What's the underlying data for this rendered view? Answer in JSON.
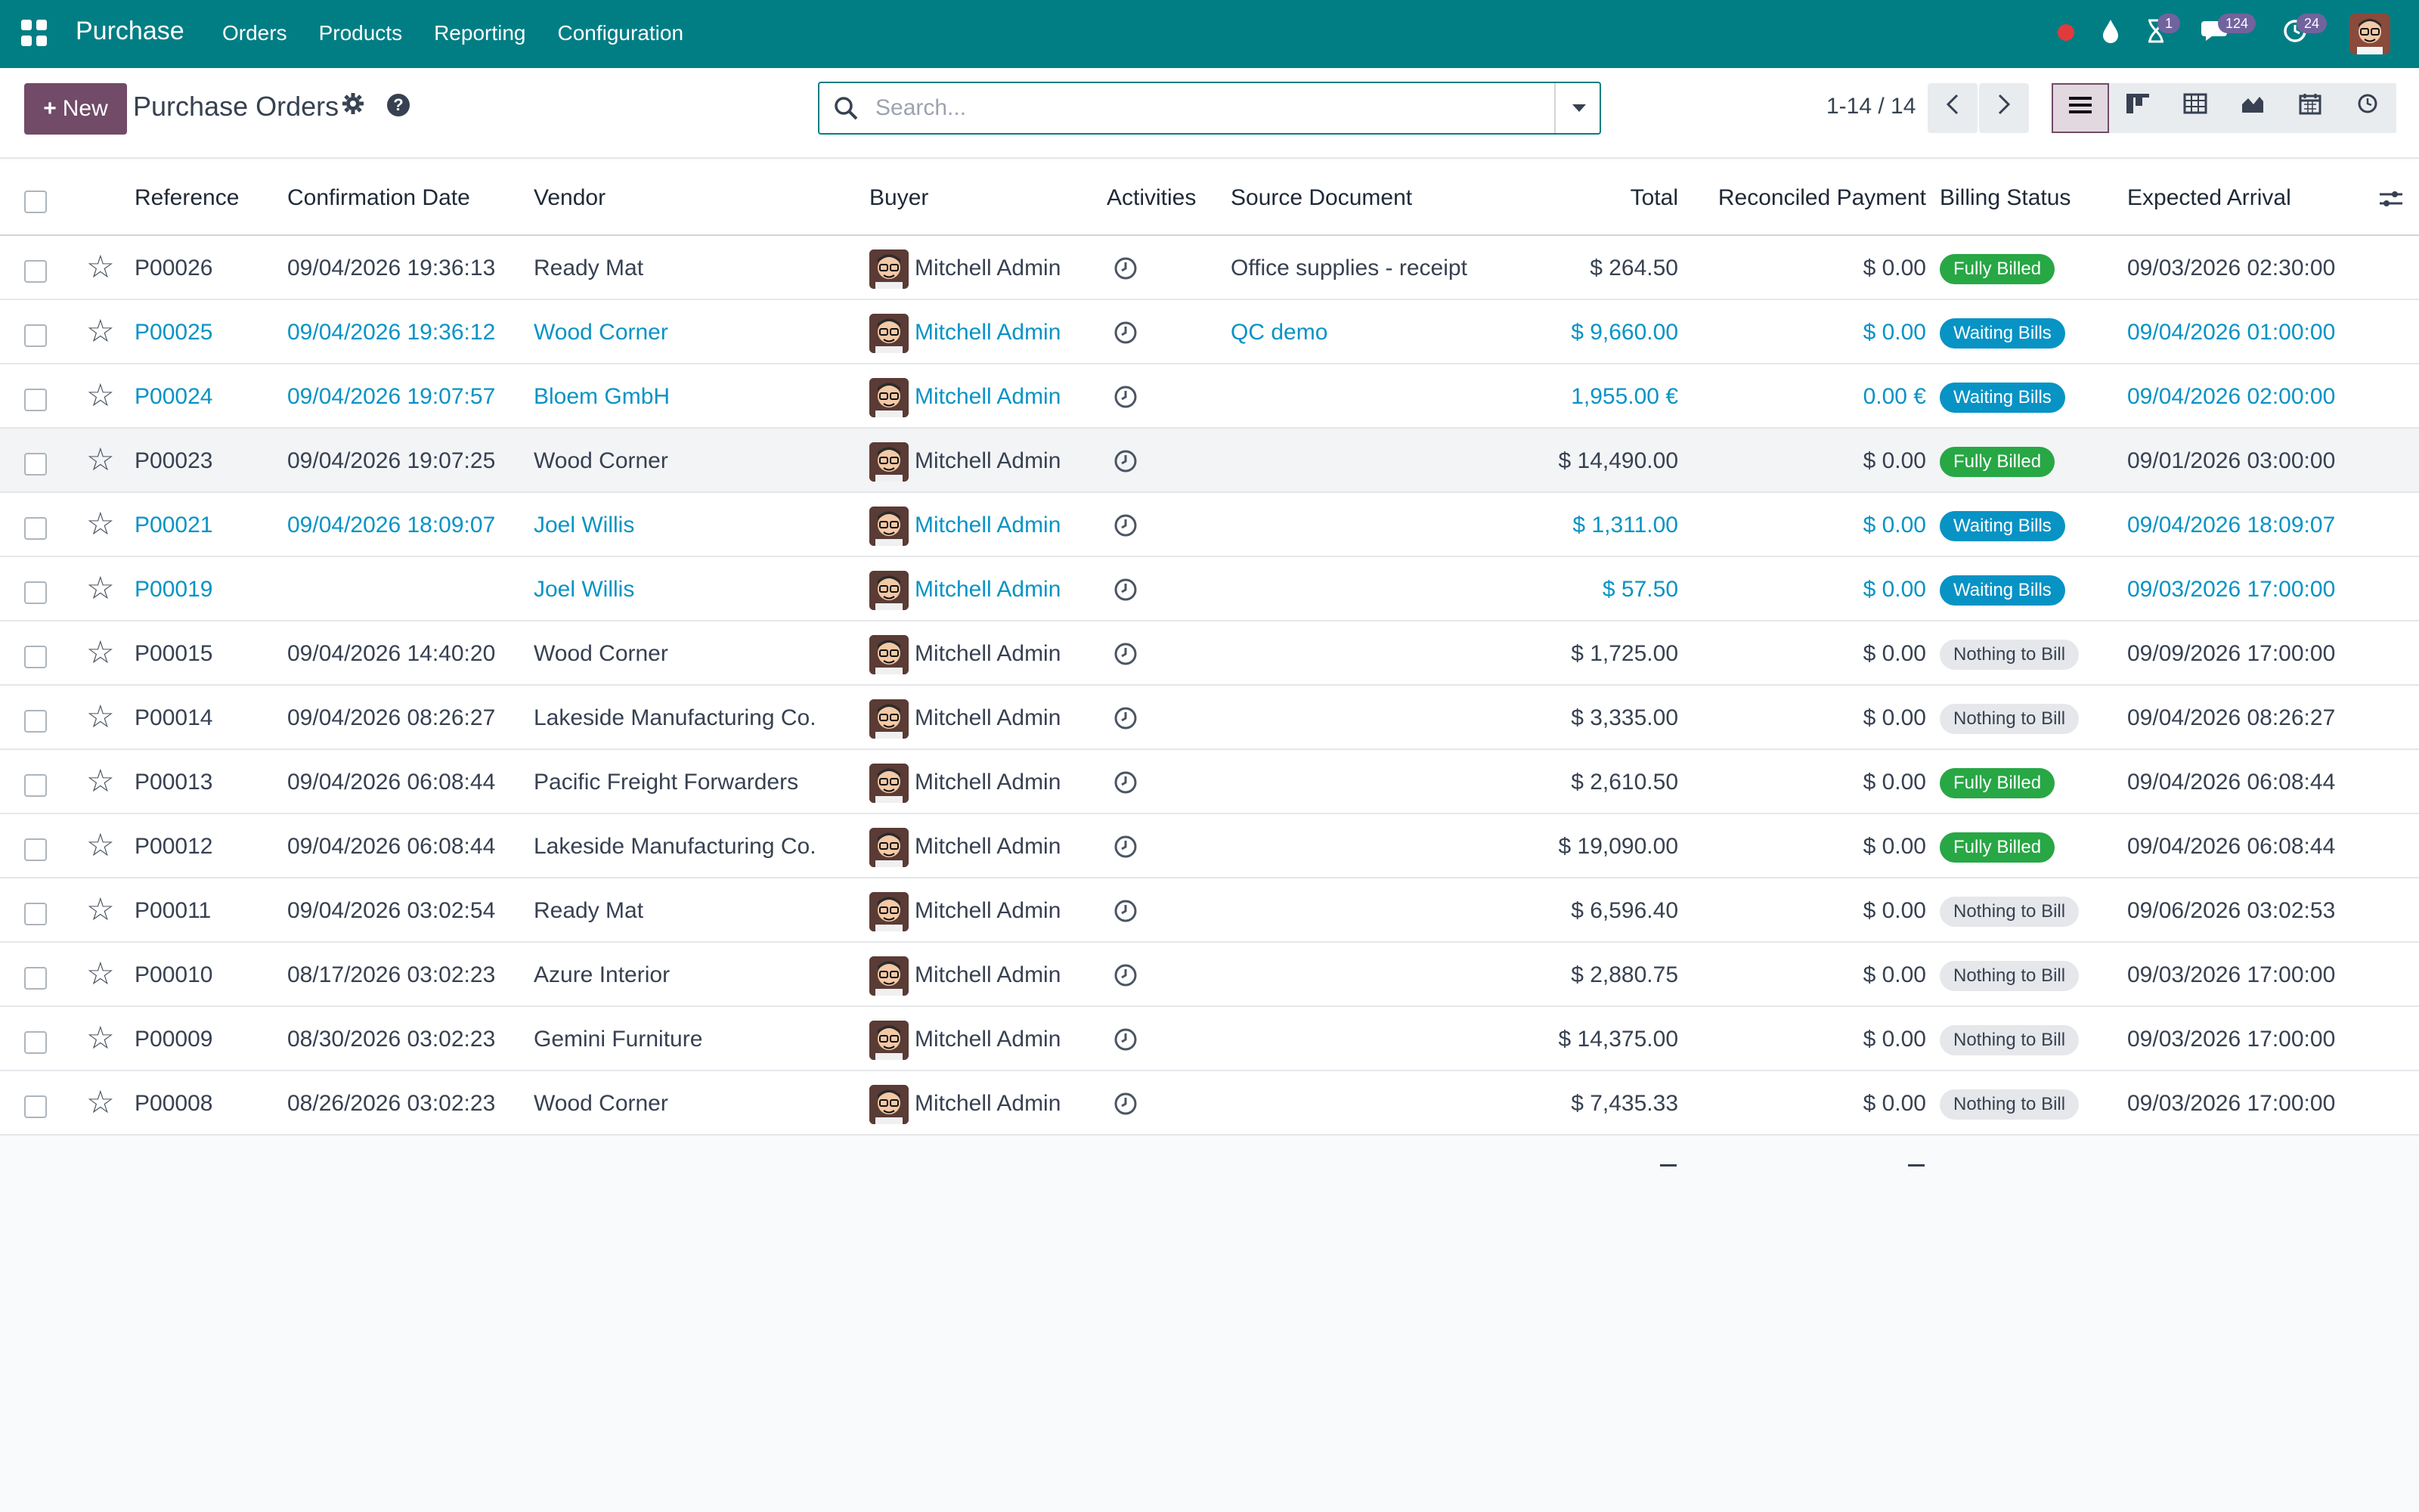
{
  "navbar": {
    "app_name": "Purchase",
    "menu": [
      "Orders",
      "Products",
      "Reporting",
      "Configuration"
    ],
    "activity_count": "1",
    "messages_count": "124",
    "activities_count": "24",
    "color": "#017e84"
  },
  "control": {
    "new_label": "New",
    "title": "Purchase Orders",
    "search_placeholder": "Search...",
    "pager": "1-14 / 14"
  },
  "columns": {
    "reference": "Reference",
    "confirmation_date": "Confirmation Date",
    "vendor": "Vendor",
    "buyer": "Buyer",
    "activities": "Activities",
    "source_document": "Source Document",
    "total": "Total",
    "reconciled_payment": "Reconciled Payment",
    "billing_status": "Billing Status",
    "expected_arrival": "Expected Arrival"
  },
  "rows": [
    {
      "ref": "P00026",
      "date": "09/04/2026 19:36:13",
      "vendor": "Ready Mat",
      "buyer": "Mitchell Admin",
      "source": "Office supplies - receipt",
      "total": "$ 264.50",
      "paid": "$ 0.00",
      "status": "Fully Billed",
      "status_kind": "fully",
      "arrival": "09/03/2026 02:30:00",
      "blue": false
    },
    {
      "ref": "P00025",
      "date": "09/04/2026 19:36:12",
      "vendor": "Wood Corner",
      "buyer": "Mitchell Admin",
      "source": "QC demo",
      "total": "$ 9,660.00",
      "paid": "$ 0.00",
      "status": "Waiting Bills",
      "status_kind": "waiting",
      "arrival": "09/04/2026 01:00:00",
      "blue": true
    },
    {
      "ref": "P00024",
      "date": "09/04/2026 19:07:57",
      "vendor": "Bloem GmbH",
      "buyer": "Mitchell Admin",
      "source": "",
      "total": "1,955.00 €",
      "paid": "0.00 €",
      "status": "Waiting Bills",
      "status_kind": "waiting",
      "arrival": "09/04/2026 02:00:00",
      "blue": true
    },
    {
      "ref": "P00023",
      "date": "09/04/2026 19:07:25",
      "vendor": "Wood Corner",
      "buyer": "Mitchell Admin",
      "source": "",
      "total": "$ 14,490.00",
      "paid": "$ 0.00",
      "status": "Fully Billed",
      "status_kind": "fully",
      "arrival": "09/01/2026 03:00:00",
      "blue": false
    },
    {
      "ref": "P00021",
      "date": "09/04/2026 18:09:07",
      "vendor": "Joel Willis",
      "buyer": "Mitchell Admin",
      "source": "",
      "total": "$ 1,311.00",
      "paid": "$ 0.00",
      "status": "Waiting Bills",
      "status_kind": "waiting",
      "arrival": "09/04/2026 18:09:07",
      "blue": true
    },
    {
      "ref": "P00019",
      "date": "",
      "vendor": "Joel Willis",
      "buyer": "Mitchell Admin",
      "source": "",
      "total": "$ 57.50",
      "paid": "$ 0.00",
      "status": "Waiting Bills",
      "status_kind": "waiting",
      "arrival": "09/03/2026 17:00:00",
      "blue": true
    },
    {
      "ref": "P00015",
      "date": "09/04/2026 14:40:20",
      "vendor": "Wood Corner",
      "buyer": "Mitchell Admin",
      "source": "",
      "total": "$ 1,725.00",
      "paid": "$ 0.00",
      "status": "Nothing to Bill",
      "status_kind": "nothing",
      "arrival": "09/09/2026 17:00:00",
      "blue": false
    },
    {
      "ref": "P00014",
      "date": "09/04/2026 08:26:27",
      "vendor": "Lakeside Manufacturing Co.",
      "buyer": "Mitchell Admin",
      "source": "",
      "total": "$ 3,335.00",
      "paid": "$ 0.00",
      "status": "Nothing to Bill",
      "status_kind": "nothing",
      "arrival": "09/04/2026 08:26:27",
      "blue": false
    },
    {
      "ref": "P00013",
      "date": "09/04/2026 06:08:44",
      "vendor": "Pacific Freight Forwarders",
      "buyer": "Mitchell Admin",
      "source": "",
      "total": "$ 2,610.50",
      "paid": "$ 0.00",
      "status": "Fully Billed",
      "status_kind": "fully",
      "arrival": "09/04/2026 06:08:44",
      "blue": false
    },
    {
      "ref": "P00012",
      "date": "09/04/2026 06:08:44",
      "vendor": "Lakeside Manufacturing Co.",
      "buyer": "Mitchell Admin",
      "source": "",
      "total": "$ 19,090.00",
      "paid": "$ 0.00",
      "status": "Fully Billed",
      "status_kind": "fully",
      "arrival": "09/04/2026 06:08:44",
      "blue": false
    },
    {
      "ref": "P00011",
      "date": "09/04/2026 03:02:54",
      "vendor": "Ready Mat",
      "buyer": "Mitchell Admin",
      "source": "",
      "total": "$ 6,596.40",
      "paid": "$ 0.00",
      "status": "Nothing to Bill",
      "status_kind": "nothing",
      "arrival": "09/06/2026 03:02:53",
      "blue": false
    },
    {
      "ref": "P00010",
      "date": "08/17/2026 03:02:23",
      "vendor": "Azure Interior",
      "buyer": "Mitchell Admin",
      "source": "",
      "total": "$ 2,880.75",
      "paid": "$ 0.00",
      "status": "Nothing to Bill",
      "status_kind": "nothing",
      "arrival": "09/03/2026 17:00:00",
      "blue": false
    },
    {
      "ref": "P00009",
      "date": "08/30/2026 03:02:23",
      "vendor": "Gemini Furniture",
      "buyer": "Mitchell Admin",
      "source": "",
      "total": "$ 14,375.00",
      "paid": "$ 0.00",
      "status": "Nothing to Bill",
      "status_kind": "nothing",
      "arrival": "09/03/2026 17:00:00",
      "blue": false
    },
    {
      "ref": "P00008",
      "date": "08/26/2026 03:02:23",
      "vendor": "Wood Corner",
      "buyer": "Mitchell Admin",
      "source": "",
      "total": "$ 7,435.33",
      "paid": "$ 0.00",
      "status": "Nothing to Bill",
      "status_kind": "nothing",
      "arrival": "09/03/2026 17:00:00",
      "blue": false
    }
  ],
  "colors": {
    "brand": "#017e84",
    "primary_button": "#714b67",
    "link": "#0893c5",
    "fully_billed": "#28a745",
    "waiting_bills": "#0893c5",
    "nothing_to_bill": "#e5e7eb"
  }
}
